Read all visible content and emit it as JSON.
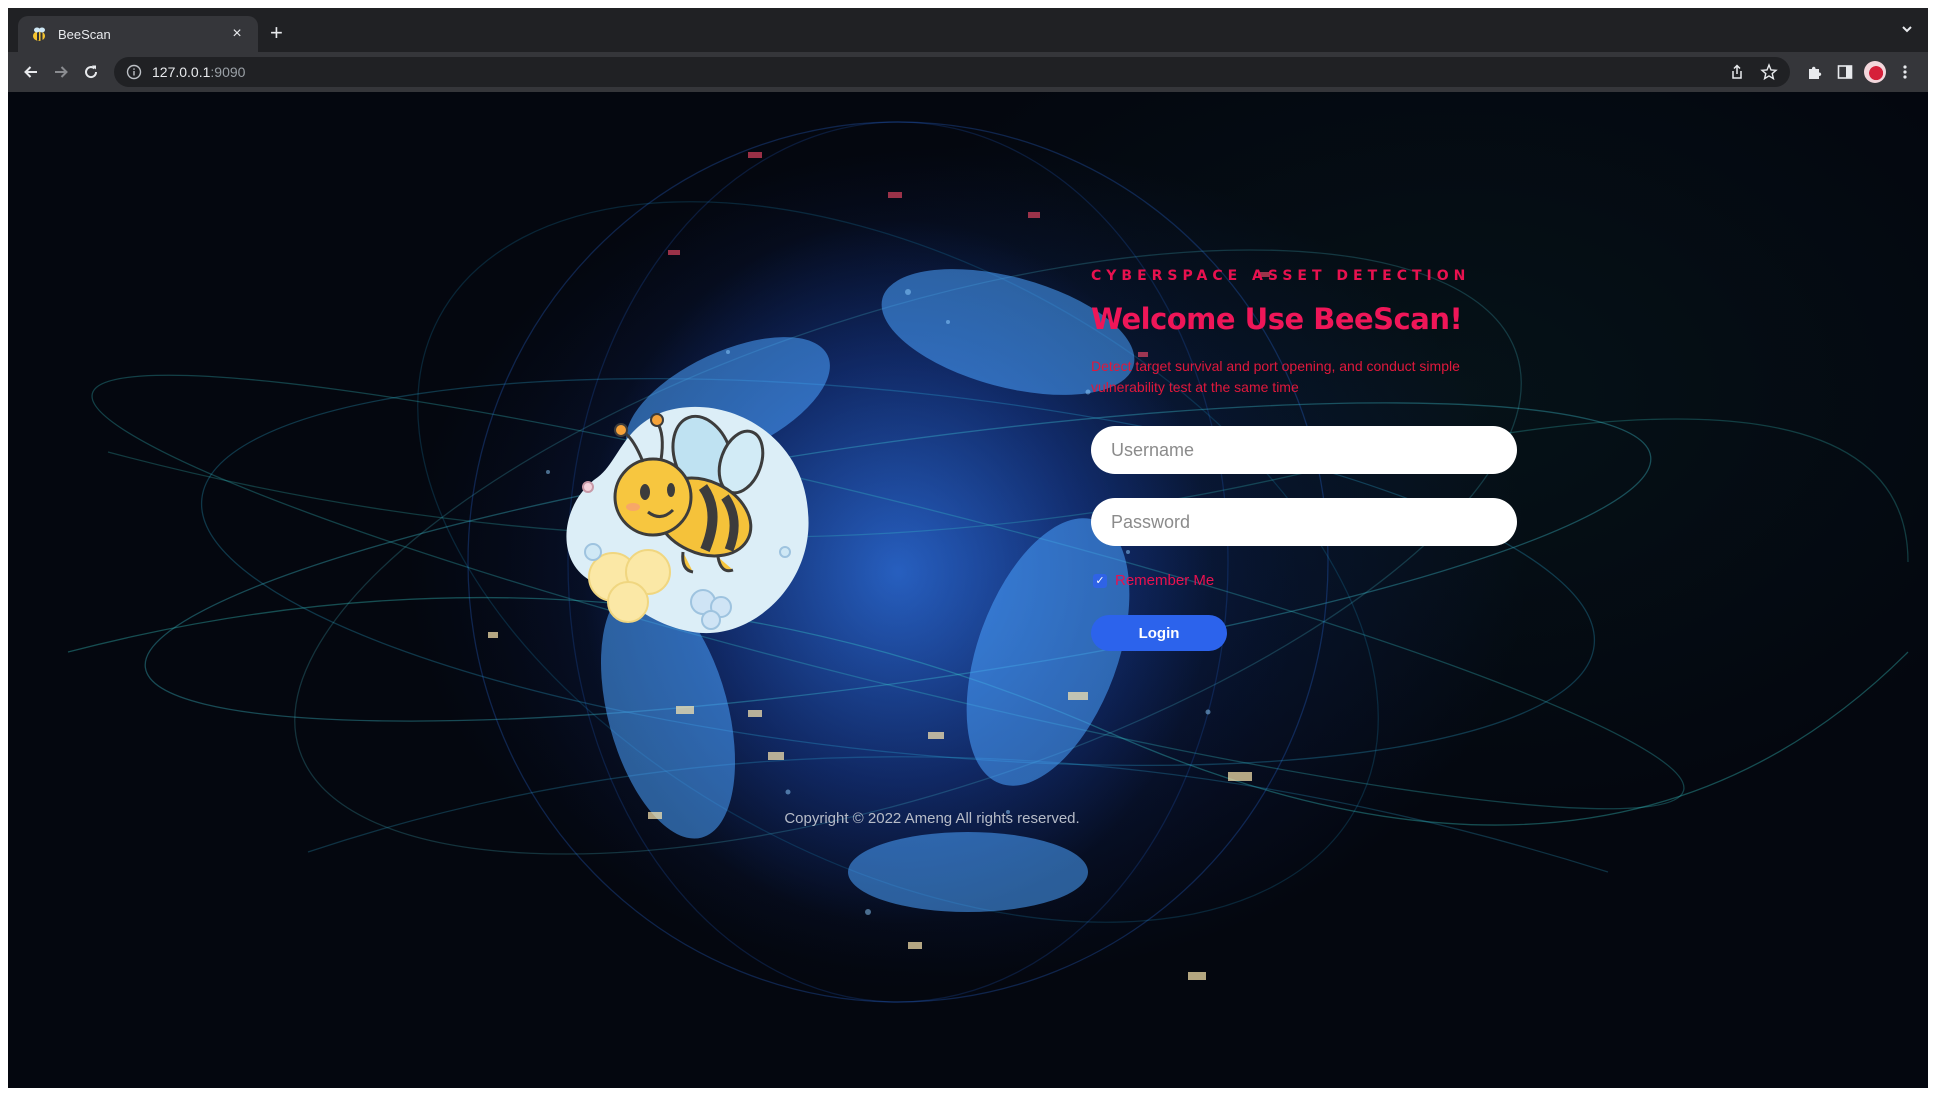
{
  "browser": {
    "tab_title": "BeeScan",
    "tab_close": "×",
    "new_tab": "+",
    "tab_menu": "⌄",
    "url_host": "127.0.0.1",
    "url_port": ":9090",
    "icons": [
      "back-icon",
      "forward-icon",
      "reload-icon",
      "info-icon",
      "share-icon",
      "star-icon",
      "extensions-icon",
      "sidepanel-icon",
      "profile-avatar",
      "more-icon"
    ]
  },
  "login": {
    "eyebrow": "CYBERSPACE ASSET DETECTION",
    "heading": "Welcome Use BeeScan!",
    "subtitle": "Detect target survival and port opening, and conduct simple vulnerability test at the same time",
    "username_placeholder": "Username",
    "password_placeholder": "Password",
    "remember_label": "Remember Me",
    "remember_checked": true,
    "login_label": "Login"
  },
  "footer": {
    "copyright": "Copyright © 2022 Ameng All rights reserved."
  },
  "colors": {
    "accent_pink": "#ef1658",
    "button_blue": "#2c63ec",
    "background": "#04070f"
  }
}
